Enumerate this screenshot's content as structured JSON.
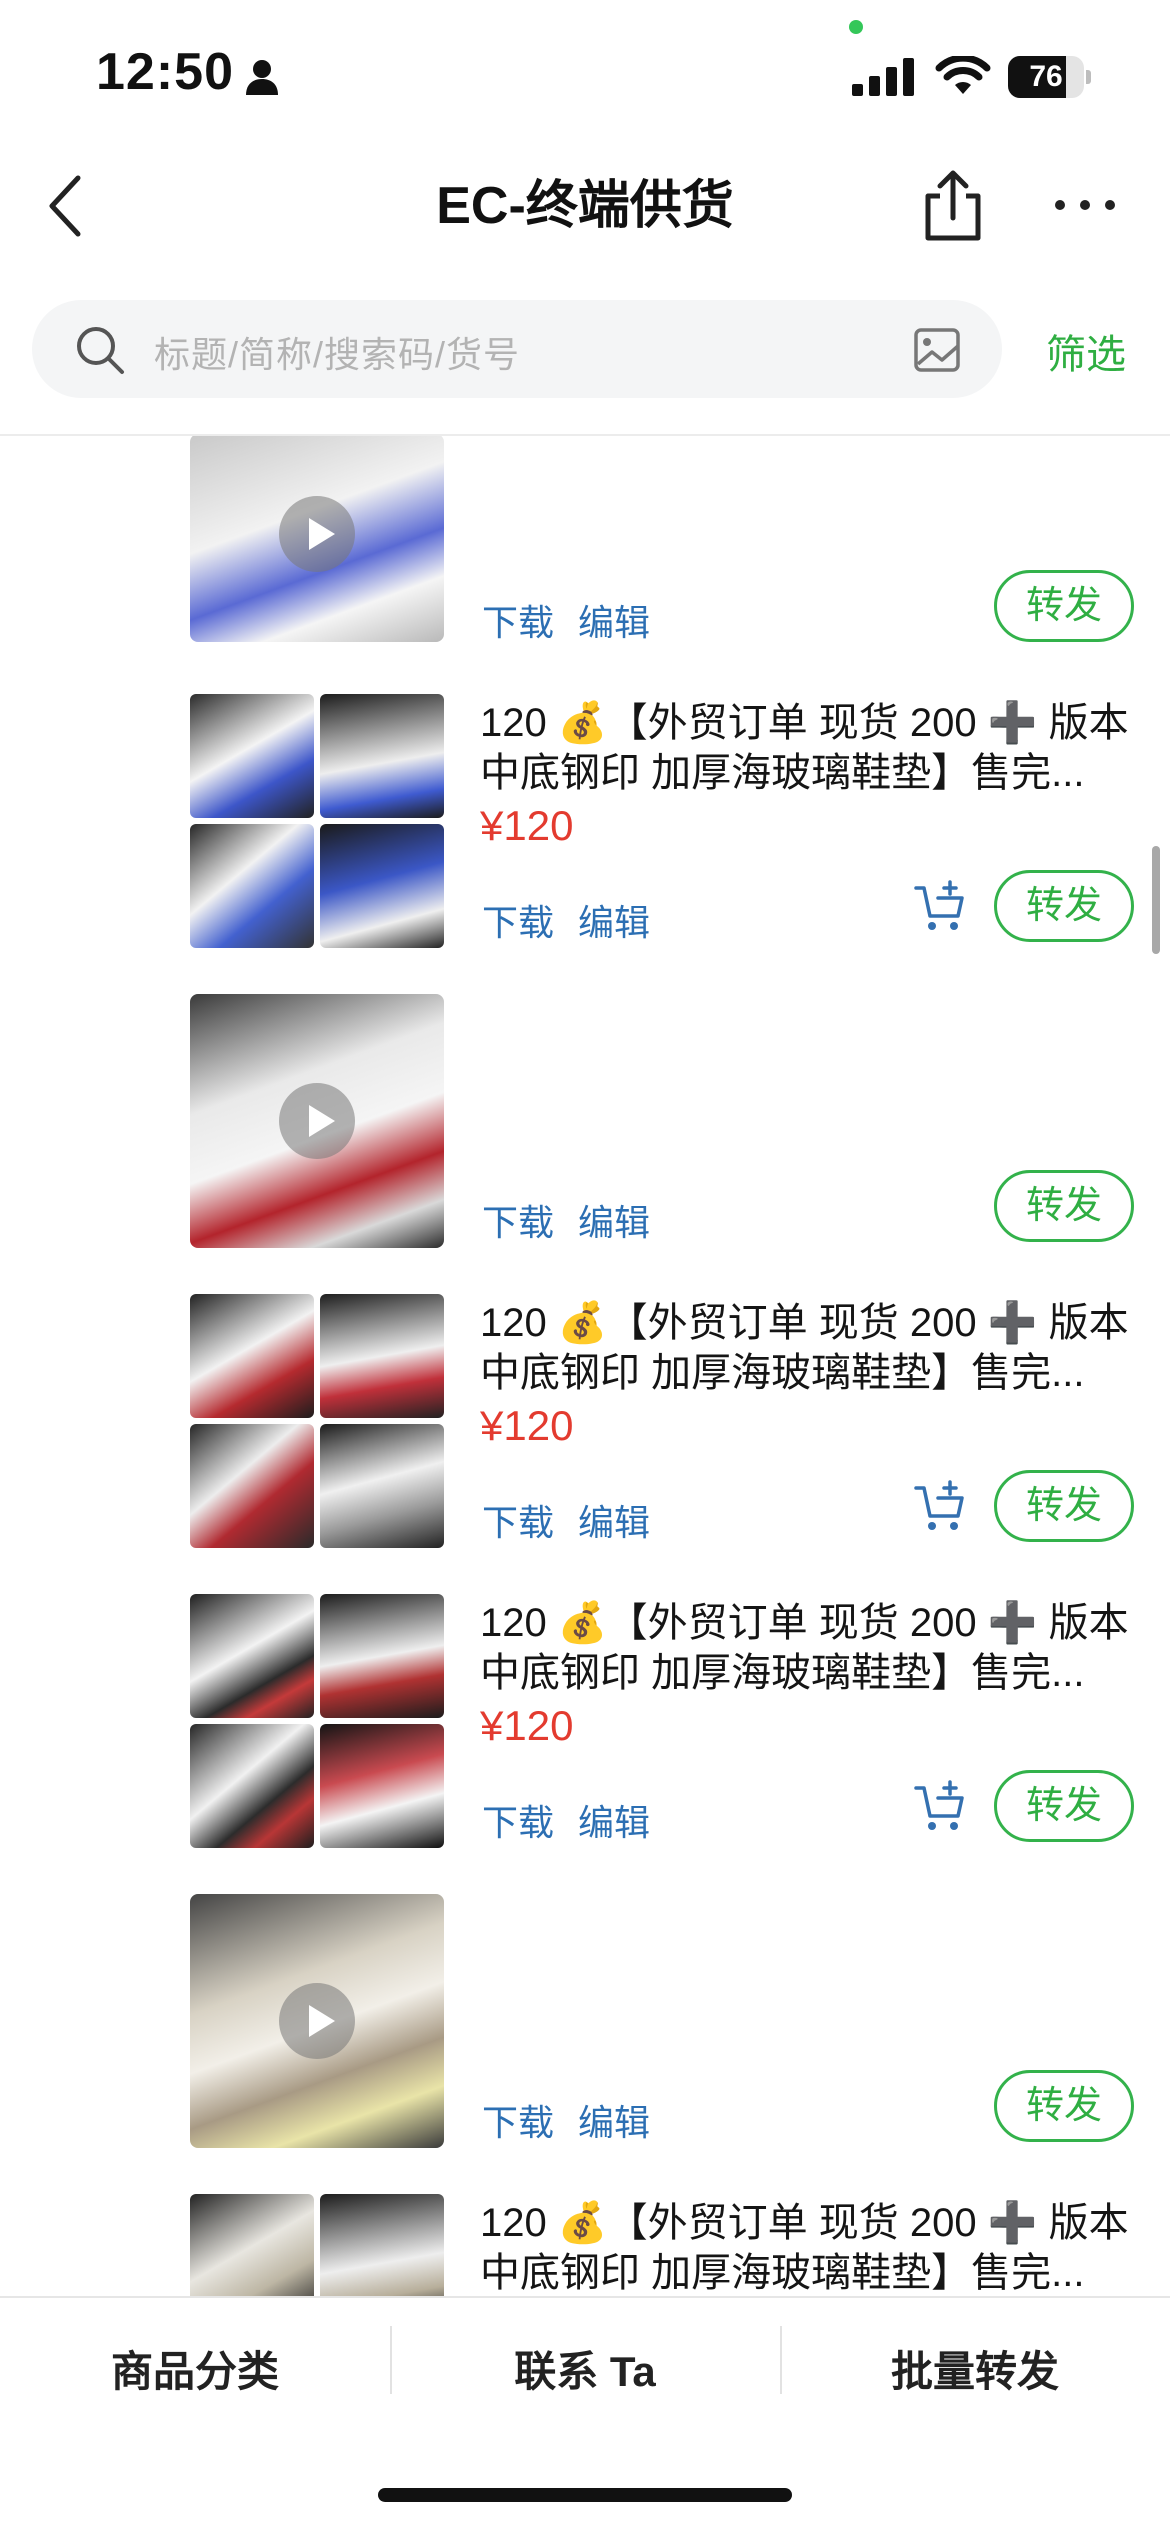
{
  "status_bar": {
    "time": "12:50",
    "battery": "76"
  },
  "nav": {
    "title": "EC-终端供货"
  },
  "search": {
    "placeholder": "标题/简称/搜索码/货号",
    "filter_label": "筛选"
  },
  "actions": {
    "download": "下载",
    "edit": "编辑",
    "forward": "转发"
  },
  "items": [
    {
      "type": "video",
      "title_line1": "",
      "title_line2": "",
      "price": ""
    },
    {
      "type": "grid",
      "title_line1": "120 💰【外贸订单 现货 200 ➕ 版本",
      "title_line2": "中底钢印 加厚海玻璃鞋垫】售完...",
      "price": "¥120"
    },
    {
      "type": "video",
      "title_line1": "",
      "title_line2": "",
      "price": ""
    },
    {
      "type": "grid",
      "title_line1": "120 💰【外贸订单 现货 200 ➕ 版本",
      "title_line2": "中底钢印 加厚海玻璃鞋垫】售完...",
      "price": "¥120"
    },
    {
      "type": "grid",
      "title_line1": "120 💰【外贸订单 现货 200 ➕ 版本",
      "title_line2": "中底钢印 加厚海玻璃鞋垫】售完...",
      "price": "¥120"
    },
    {
      "type": "video",
      "title_line1": "",
      "title_line2": "",
      "price": ""
    },
    {
      "type": "grid",
      "title_line1": "120 💰【外贸订单 现货 200 ➕ 版本",
      "title_line2": "中底钢印 加厚海玻璃鞋垫】售完...",
      "price": ""
    }
  ],
  "bottom_tabs": [
    "商品分类",
    "联系 Ta",
    "批量转发"
  ],
  "colors": {
    "accent_green": "#2fae42",
    "price_red": "#e33b2f",
    "link_blue": "#2c6fb3"
  }
}
